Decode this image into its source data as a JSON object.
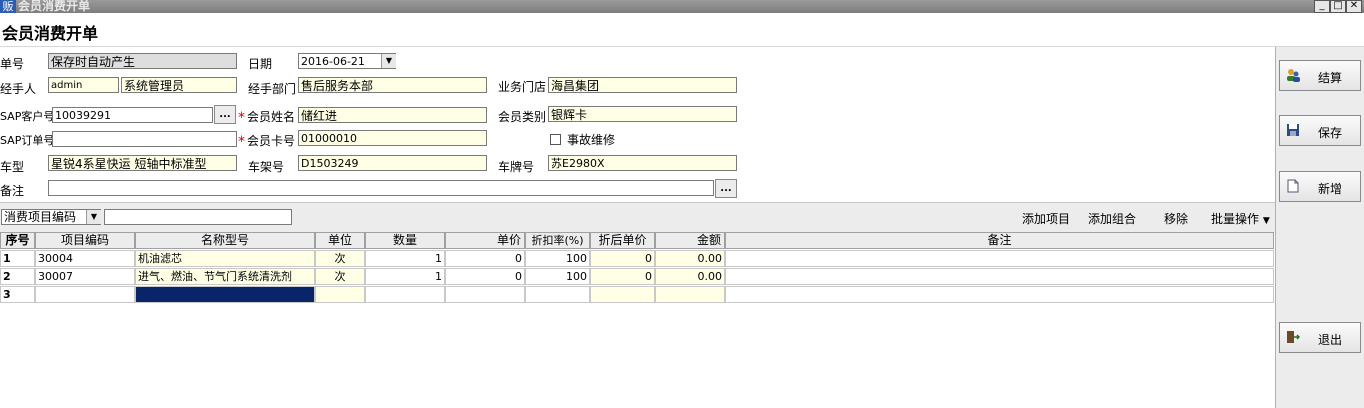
{
  "window": {
    "icon_text": "贩",
    "title": "会员消费开单",
    "min": "_",
    "max": "□",
    "close": "✕"
  },
  "header": {
    "title": "会员消费开单"
  },
  "form": {
    "order_no": {
      "label": "单号",
      "value": "保存时自动产生"
    },
    "date": {
      "label": "日期",
      "value": "2016-06-21"
    },
    "handler": {
      "label": "经手人",
      "code": "admin",
      "name": "系统管理员"
    },
    "dept": {
      "label": "经手部门",
      "value": "售后服务本部"
    },
    "store": {
      "label": "业务门店",
      "value": "海昌集团"
    },
    "sap_customer": {
      "label": "SAP客户号",
      "value": "10039291",
      "btn": "..."
    },
    "member_name": {
      "label": "会员姓名",
      "value": "储红进",
      "required": "*"
    },
    "member_type": {
      "label": "会员类别",
      "value": "银辉卡"
    },
    "sap_order": {
      "label": "SAP订单号",
      "value": ""
    },
    "member_card": {
      "label": "会员卡号",
      "value": "01000010",
      "required": "*"
    },
    "accident": {
      "label": "事故维修"
    },
    "car_model": {
      "label": "车型",
      "value": "星锐4系星快运 短轴中标准型"
    },
    "frame_no": {
      "label": "车架号",
      "value": "D1503249"
    },
    "plate_no": {
      "label": "车牌号",
      "value": "苏E2980X"
    },
    "remark": {
      "label": "备注",
      "value": "",
      "btn": "..."
    }
  },
  "toolbar": {
    "search_field": "消费项目编码",
    "search_value": "",
    "add_item": "添加项目",
    "add_combo": "添加组合",
    "remove": "移除",
    "batch": "批量操作"
  },
  "grid": {
    "columns": [
      "序号",
      "项目编码",
      "名称型号",
      "单位",
      "数量",
      "单价",
      "折扣率(%)",
      "折后单价",
      "金额",
      "备注"
    ],
    "rows": [
      {
        "no": "1",
        "code": "30004",
        "name": "机油滤芯",
        "unit": "次",
        "qty": "1",
        "price": "0",
        "discount": "100",
        "dprice": "0",
        "amount": "0.00",
        "remark": ""
      },
      {
        "no": "2",
        "code": "30007",
        "name": "进气、燃油、节气门系统清洗剂",
        "unit": "次",
        "qty": "1",
        "price": "0",
        "discount": "100",
        "dprice": "0",
        "amount": "0.00",
        "remark": ""
      },
      {
        "no": "3",
        "code": "",
        "name": "",
        "unit": "",
        "qty": "",
        "price": "",
        "discount": "",
        "dprice": "",
        "amount": "",
        "remark": ""
      }
    ]
  },
  "actions": {
    "checkout": "结算",
    "save": "保存",
    "new": "新增",
    "exit": "退出"
  },
  "colors": {
    "selection": "#0a246a",
    "field_bg": "#ffffe6",
    "required": "#d40000"
  }
}
